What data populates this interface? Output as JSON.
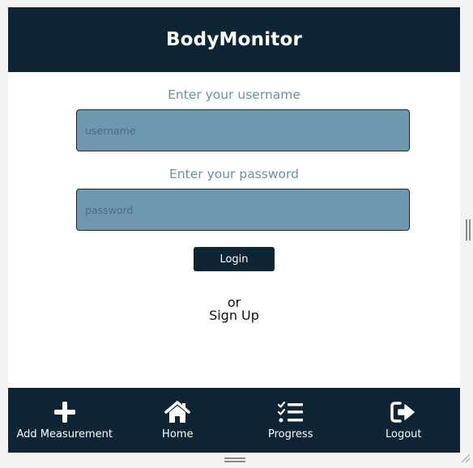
{
  "app": {
    "title": "BodyMonitor"
  },
  "login_form": {
    "username_label": "Enter your username",
    "username_placeholder": "username",
    "username_value": "",
    "password_label": "Enter your password",
    "password_placeholder": "password",
    "password_value": "",
    "login_button_label": "Login",
    "or_text": "or",
    "signup_link_label": "Sign Up"
  },
  "bottom_nav": {
    "items": [
      {
        "label": "Add Measurement",
        "icon": "plus-icon"
      },
      {
        "label": "Home",
        "icon": "home-icon"
      },
      {
        "label": "Progress",
        "icon": "checklist-icon"
      },
      {
        "label": "Logout",
        "icon": "logout-icon"
      }
    ]
  },
  "colors": {
    "header_bg": "#0d2535",
    "label_text": "#6a8fa7",
    "input_bg": "#6e98b0",
    "page_bg": "#ffffff"
  }
}
